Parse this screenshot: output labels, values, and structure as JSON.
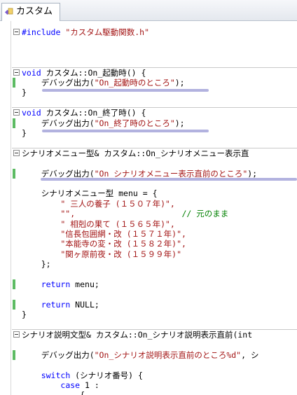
{
  "tab": {
    "title": "カスタム"
  },
  "code_lines": [
    {
      "t": "#include \"カスタム駆動関数.h\"",
      "kind": "include"
    },
    {
      "t": "",
      "kind": "plain"
    },
    {
      "t": "",
      "kind": "plain"
    },
    {
      "t": "",
      "kind": "plain"
    },
    {
      "t": "void カスタム::On_起動時() {",
      "kind": "func"
    },
    {
      "t": "    デバッグ出力(\"On_起動時のところ\");",
      "kind": "debug"
    },
    {
      "t": "}",
      "kind": "plain"
    },
    {
      "t": "",
      "kind": "plain"
    },
    {
      "t": "void カスタム::On_終了時() {",
      "kind": "func"
    },
    {
      "t": "    デバッグ出力(\"On_終了時のところ\");",
      "kind": "debug"
    },
    {
      "t": "}",
      "kind": "plain"
    },
    {
      "t": "",
      "kind": "plain"
    },
    {
      "t": "シナリオメニュー型& カスタム::On_シナリオメニュー表示直",
      "kind": "funcsig"
    },
    {
      "t": "",
      "kind": "plain"
    },
    {
      "t": "    デバッグ出力(\"On_シナリオメニュー表示直前のところ\");",
      "kind": "debug"
    },
    {
      "t": "",
      "kind": "plain"
    },
    {
      "t": "    シナリオメニュー型 menu = {",
      "kind": "plain"
    },
    {
      "t": "        \" 三人の養子 (１５０７年)\",",
      "kind": "str"
    },
    {
      "t": "        \"\",",
      "kind": "strcomment",
      "comment": "// 元のまま"
    },
    {
      "t": "        \" 相剋の果て (１５６５年)\",",
      "kind": "str"
    },
    {
      "t": "        \"信長包囲網・改 (１５７１年)\",",
      "kind": "str"
    },
    {
      "t": "        \"本能寺の変・改 (１５８２年)\",",
      "kind": "str"
    },
    {
      "t": "        \"関ヶ原前夜・改 (１５９９年)\"",
      "kind": "str"
    },
    {
      "t": "    };",
      "kind": "plain"
    },
    {
      "t": "",
      "kind": "plain"
    },
    {
      "t": "    return menu;",
      "kind": "ret"
    },
    {
      "t": "",
      "kind": "plain"
    },
    {
      "t": "    return NULL;",
      "kind": "ret"
    },
    {
      "t": "}",
      "kind": "plain"
    },
    {
      "t": "",
      "kind": "plain"
    },
    {
      "t": "シナリオ説明文型& カスタム::On_シナリオ説明表示直前(int",
      "kind": "funcsig"
    },
    {
      "t": "",
      "kind": "plain"
    },
    {
      "t": "    デバッグ出力(\"On_シナリオ説明表示直前のところ%d\", シ",
      "kind": "debug"
    },
    {
      "t": "",
      "kind": "plain"
    },
    {
      "t": "    switch (シナリオ番号) {",
      "kind": "switch"
    },
    {
      "t": "        case 1 :",
      "kind": "case"
    },
    {
      "t": "            {",
      "kind": "plain"
    },
    {
      "t": "                /*",
      "kind": "cmt"
    }
  ]
}
